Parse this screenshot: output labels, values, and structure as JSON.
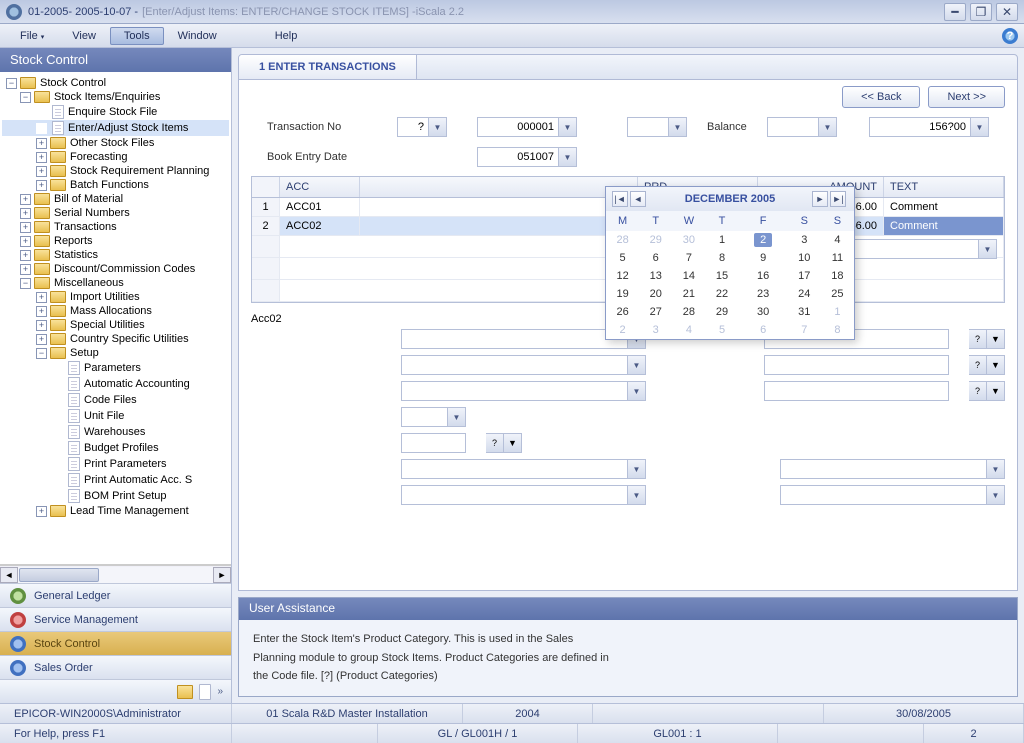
{
  "title": {
    "main": "01-2005- 2005-10-07 -",
    "sub": "[Enter/Adjust Items: ENTER/CHANGE STOCK ITEMS] -iScala 2.2"
  },
  "menu": {
    "file": "File",
    "view": "View",
    "tools": "Tools",
    "window": "Window",
    "help": "Help"
  },
  "sidebar": {
    "title": "Stock Control",
    "tree": {
      "root": "Stock Control",
      "n1": "Stock Items/Enquiries",
      "n1_1": "Enquire Stock File",
      "n1_2": "Enter/Adjust Stock Items",
      "n1_3": "Other Stock Files",
      "n1_4": "Forecasting",
      "n1_5": "Stock Requirement Planning",
      "n1_6": "Batch Functions",
      "n2": "Bill of Material",
      "n3": "Serial Numbers",
      "n4": "Transactions",
      "n5": "Reports",
      "n6": "Statistics",
      "n7": "Discount/Commission Codes",
      "n8": "Miscellaneous",
      "n8_1": "Import Utilities",
      "n8_2": "Mass Allocations",
      "n8_3": "Special Utilities",
      "n8_4": "Country Specific Utilities",
      "n8_5": "Setup",
      "n8_5_1": "Parameters",
      "n8_5_2": "Automatic Accounting",
      "n8_5_3": "Code Files",
      "n8_5_4": "Unit File",
      "n8_5_5": "Warehouses",
      "n8_5_6": "Budget Profiles",
      "n8_5_7": "Print Parameters",
      "n8_5_8": "Print Automatic Acc. S",
      "n8_5_9": "BOM Print Setup",
      "n8_6": "Lead Time Management"
    },
    "nav": {
      "gl": "General Ledger",
      "sm": "Service Management",
      "sc": "Stock Control",
      "so": "Sales Order"
    }
  },
  "panel": {
    "tab": "1 ENTER TRANSACTIONS",
    "back": "<< Back",
    "next": "Next >>"
  },
  "form": {
    "transNo_lbl": "Transaction No",
    "transNo_val": "000001",
    "balance_lbl": "Balance",
    "balance_val": "156?00",
    "bookEntry_lbl": "Book Entry Date",
    "bookEntry_val": "051007",
    "acc_desc": "Acc02"
  },
  "grid": {
    "h_acc": "ACC",
    "h_prd": "PRD",
    "h_amt": "AMOUNT",
    "h_txt": "TEXT",
    "r1_num": "1",
    "r1_acc": "ACC01",
    "r1_amt": "156.00",
    "r1_txt": "Comment",
    "r2_num": "2",
    "r2_acc": "ACC02",
    "r2_amt": "-156.00",
    "r2_txt": "Comment"
  },
  "calendar": {
    "title": "DECEMBER 2005",
    "dh": [
      "M",
      "T",
      "W",
      "T",
      "F",
      "S",
      "S"
    ],
    "w1": [
      "28",
      "29",
      "30",
      "1",
      "2",
      "3",
      "4"
    ],
    "w2": [
      "5",
      "6",
      "7",
      "8",
      "9",
      "10",
      "11"
    ],
    "w3": [
      "12",
      "13",
      "14",
      "15",
      "16",
      "17",
      "18"
    ],
    "w4": [
      "19",
      "20",
      "21",
      "22",
      "23",
      "24",
      "25"
    ],
    "w5": [
      "26",
      "27",
      "28",
      "29",
      "30",
      "31",
      "1"
    ],
    "w6": [
      "2",
      "3",
      "4",
      "5",
      "6",
      "7",
      "8"
    ]
  },
  "assist": {
    "title": "User Assistance",
    "l1": "Enter the Stock Item's Product Category. This is used in the Sales",
    "l2": "Planning module to group Stock Items. Product Categories are defined in",
    "l3": "the Code file. [?] (Product Categories)"
  },
  "status1": {
    "c1": "EPICOR-WIN2000S\\Administrator",
    "c2": "01 Scala R&D Master Installation",
    "c3": "2004",
    "c4": "30/08/2005"
  },
  "status2": {
    "c1": "For Help, press F1",
    "c2": "GL / GL001H / 1",
    "c3": "GL001 : 1",
    "c4": "2"
  }
}
